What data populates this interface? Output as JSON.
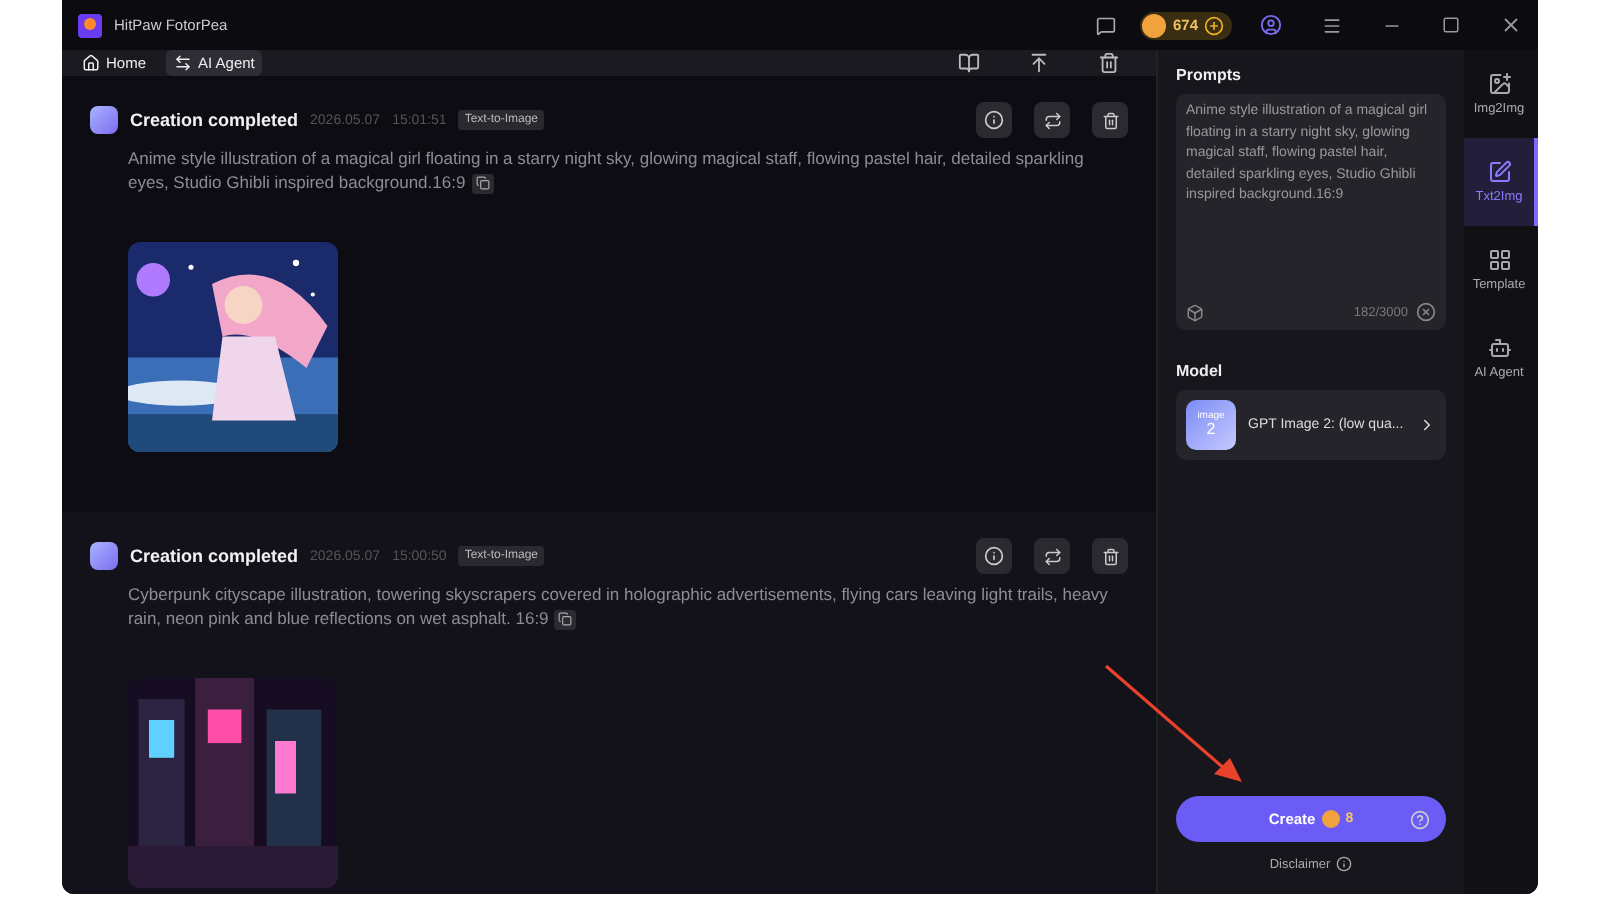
{
  "window": {
    "title": "HitPaw FotorPea",
    "credits": "674"
  },
  "nav": [
    {
      "label": "Home",
      "kind": "home",
      "selected": false
    },
    {
      "label": "AI Agent",
      "kind": "agent",
      "selected": true
    }
  ],
  "records": [
    {
      "status": "Creation completed",
      "date": "2026.05.07",
      "time": "15:01:51",
      "tag": "Text-to-Image",
      "prompt": "Anime style illustration of a magical girl floating in a starry night sky, glowing magical staff, flowing pastel hair, detailed sparkling eyes, Studio Ghibli inspired background.16:9"
    },
    {
      "status": "Creation completed",
      "date": "2026.05.07",
      "time": "15:00:50",
      "tag": "Text-to-Image",
      "prompt": "Cyberpunk cityscape illustration, towering skyscrapers covered in holographic advertisements, flying cars leaving light trails, heavy rain, neon pink and blue reflections on wet asphalt. 16:9"
    }
  ],
  "prompts": {
    "title": "Prompts",
    "value": "Anime style illustration of a magical girl floating in a starry night sky, glowing magical staff, flowing pastel hair, detailed sparkling eyes, Studio Ghibli inspired background.16:9",
    "counter": "182/3000"
  },
  "model": {
    "title": "Model",
    "name": "GPT Image 2: (low qua...",
    "thumb": [
      "image",
      "2"
    ]
  },
  "create": {
    "label": "Create",
    "cost": "8",
    "disclaimer": "Disclaimer"
  },
  "sidebar": [
    {
      "label": "Img2Img",
      "kind": "img",
      "selected": false
    },
    {
      "label": "Txt2Img",
      "kind": "txt",
      "selected": true
    },
    {
      "label": "Template",
      "kind": "template",
      "selected": false
    },
    {
      "label": "AI Agent",
      "kind": "agent",
      "selected": false
    }
  ]
}
